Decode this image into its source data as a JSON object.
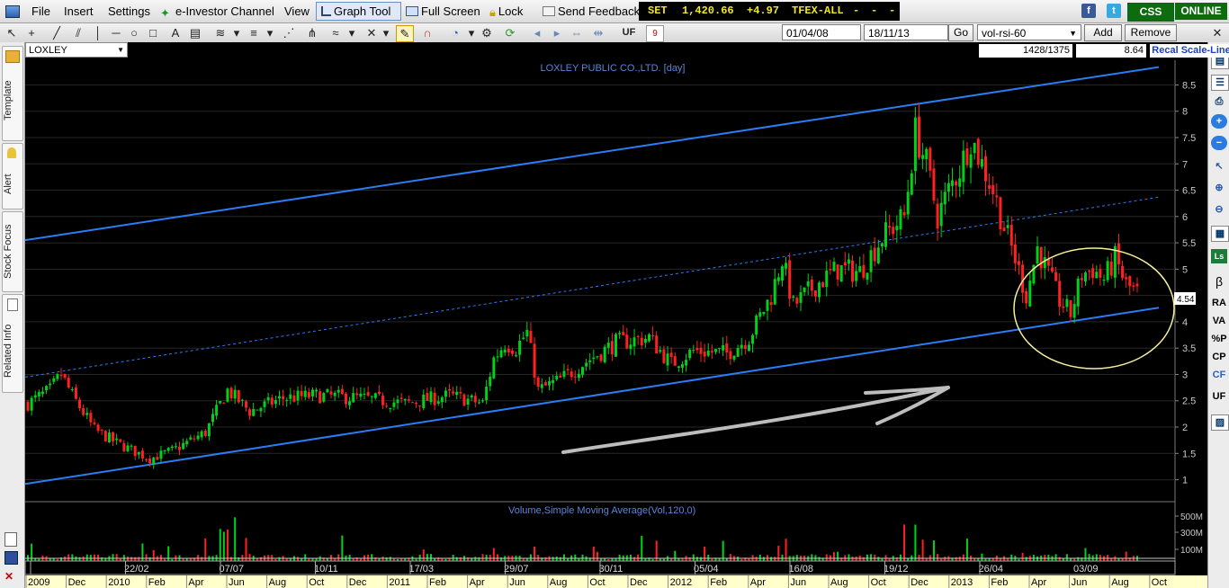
{
  "menu": {
    "file": "File",
    "insert": "Insert",
    "settings": "Settings",
    "einvestor": "e-Investor Channel",
    "view": "View",
    "graph_tool": "Graph Tool",
    "full_screen": "Full Screen",
    "lock": "Lock",
    "send_feedback": "Send Feedback"
  },
  "ticker": {
    "index_name": "SET",
    "index_value": "1,420.66",
    "index_change": "+4.97",
    "tfex": "TFEX-ALL",
    "d1": "-",
    "d2": "-",
    "d3": "-"
  },
  "status": {
    "css": "CSS",
    "online": "ONLINE"
  },
  "toolbar": {
    "uf": "UF",
    "calendar_day": "9",
    "date_from": "01/04/08",
    "date_to": "18/11/13",
    "go": "Go",
    "indicator": "vol-rsi-60",
    "add": "Add",
    "remove": "Remove"
  },
  "symbol": {
    "name": "LOXLEY",
    "bars": "1428/1375",
    "price": "8.64",
    "recal": "Recal Scale-Line"
  },
  "sidebar_left": {
    "template": "Template",
    "alert": "Alert",
    "stock_focus": "Stock Focus",
    "related_info": "Related Info"
  },
  "sidebar_right": {
    "beta": "β",
    "ra": "RA",
    "va": "VA",
    "pp": "%P",
    "cp": "CP",
    "cf": "CF",
    "uf": "UF"
  },
  "colors": {
    "up": "#00d21a",
    "down": "#ff2020",
    "trend": "#2a7df4",
    "circle": "#f5f09a",
    "axis_text": "#c8c8c8",
    "grid": "#262626"
  },
  "chart_data": {
    "type": "candlestick",
    "title": "LOXLEY PUBLIC CO.,LTD. [day]",
    "ylim": [
      0.6,
      8.9
    ],
    "yticks": [
      1,
      1.5,
      2,
      2.5,
      3,
      3.5,
      4,
      4.5,
      5,
      5.5,
      6,
      6.5,
      7,
      7.5,
      8,
      8.5
    ],
    "last_price": "4.54",
    "date_markers": [
      "22/02",
      "07/07",
      "10/11",
      "17/03",
      "29/07",
      "30/11",
      "05/04",
      "16/08",
      "19/12",
      "26/04",
      "03/09"
    ],
    "month_axis": [
      "2009",
      "Dec",
      "2010",
      "Feb",
      "Apr",
      "Jun",
      "Aug",
      "Oct",
      "Dec",
      "2011",
      "Feb",
      "Apr",
      "Jun",
      "Aug",
      "Oct",
      "Dec",
      "2012",
      "Feb",
      "Apr",
      "Jun",
      "Aug",
      "Oct",
      "Dec",
      "2013",
      "Feb",
      "Apr",
      "Jun",
      "Aug",
      "Oct"
    ],
    "price_path": [
      [
        0,
        2.45
      ],
      [
        2,
        2.7
      ],
      [
        3,
        3.0
      ],
      [
        4,
        2.6
      ],
      [
        6,
        1.95
      ],
      [
        8,
        1.7
      ],
      [
        11,
        1.4
      ],
      [
        13,
        1.55
      ],
      [
        16,
        1.9
      ],
      [
        18,
        2.7
      ],
      [
        20,
        2.3
      ],
      [
        23,
        2.55
      ],
      [
        26,
        2.6
      ],
      [
        30,
        2.55
      ],
      [
        34,
        2.45
      ],
      [
        38,
        2.6
      ],
      [
        41,
        2.45
      ],
      [
        42,
        3.3
      ],
      [
        43,
        3.6
      ],
      [
        44,
        3.5
      ],
      [
        45,
        3.8
      ],
      [
        46,
        2.7
      ],
      [
        48,
        2.9
      ],
      [
        50,
        3.2
      ],
      [
        53,
        3.6
      ],
      [
        56,
        3.7
      ],
      [
        58,
        3.2
      ],
      [
        60,
        3.45
      ],
      [
        63,
        3.4
      ],
      [
        65,
        3.7
      ],
      [
        67,
        4.5
      ],
      [
        68,
        5.2
      ],
      [
        69,
        4.3
      ],
      [
        71,
        4.7
      ],
      [
        73,
        5.0
      ],
      [
        75,
        4.95
      ],
      [
        77,
        5.6
      ],
      [
        79,
        6.0
      ],
      [
        80,
        7.6
      ],
      [
        81,
        7.0
      ],
      [
        82,
        6.0
      ],
      [
        83,
        6.5
      ],
      [
        84,
        6.9
      ],
      [
        85,
        7.5
      ],
      [
        86,
        7.0
      ],
      [
        87,
        6.5
      ],
      [
        88,
        5.8
      ],
      [
        89,
        5.2
      ],
      [
        90,
        4.5
      ],
      [
        91,
        5.4
      ],
      [
        92,
        4.9
      ],
      [
        93,
        4.4
      ],
      [
        94,
        4.15
      ],
      [
        95,
        4.9
      ],
      [
        96,
        5.0
      ],
      [
        97,
        4.8
      ],
      [
        98,
        5.2
      ],
      [
        99,
        4.7
      ],
      [
        100,
        4.54
      ]
    ],
    "volume_series": {
      "title": "Volume,Simple Moving Average(Vol,120,0)",
      "ticks": [
        "500M",
        "300M",
        "100M"
      ]
    },
    "trend_lines": [
      {
        "name": "upper-channel",
        "style": "solid",
        "points": [
          [
            0,
            5.55
          ],
          [
            100,
            8.82
          ]
        ]
      },
      {
        "name": "middle-channel",
        "style": "dashed",
        "points": [
          [
            0,
            2.95
          ],
          [
            100,
            6.35
          ]
        ]
      },
      {
        "name": "lower-channel",
        "style": "solid",
        "points": [
          [
            0,
            0.92
          ],
          [
            100,
            4.25
          ]
        ]
      }
    ]
  }
}
